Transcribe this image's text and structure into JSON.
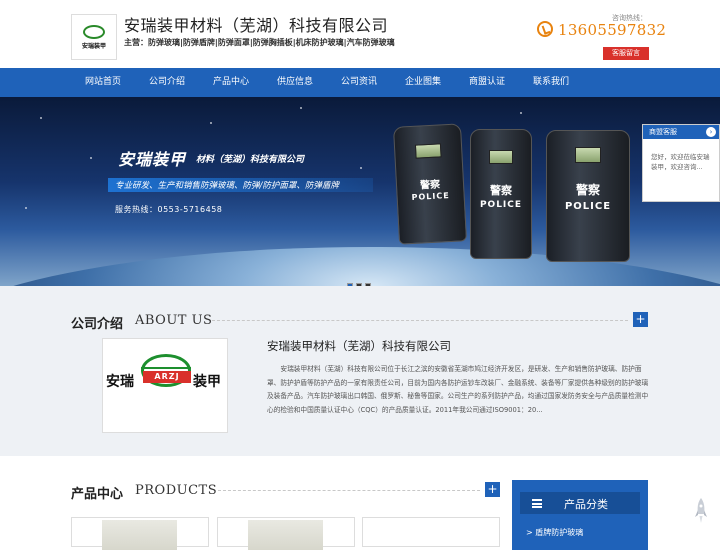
{
  "header": {
    "logo_text": "安瑞装甲",
    "company_name": "安瑞装甲材料（芜湖）科技有限公司",
    "business": "主营：防弹玻璃|防弹盾牌|防弹面罩|防弹胸插板|机床防护玻璃|汽车防弹玻璃",
    "hotline_label": "咨询热线：",
    "phone": "13605597832",
    "message_button": "客服留言"
  },
  "nav": {
    "items": [
      {
        "label": "网站首页"
      },
      {
        "label": "公司介绍"
      },
      {
        "label": "产品中心"
      },
      {
        "label": "供应信息"
      },
      {
        "label": "公司资讯"
      },
      {
        "label": "企业图集"
      },
      {
        "label": "商盟认证"
      },
      {
        "label": "联系我们"
      }
    ]
  },
  "banner": {
    "title": "安瑞装甲",
    "subtitle": "材料（芜湖）科技有限公司",
    "slogan": "专业研发、生产和销售防弹玻璃、防弹/防护面罩、防弹盾牌",
    "service": "服务热线：0553-5716458",
    "shield_cn": "警察",
    "shield_en": "POLICE",
    "slides": 3,
    "active_slide": 1
  },
  "chat": {
    "title": "商盟客服",
    "arrow": "›",
    "message": "您好，欢迎莅临安瑞装甲，欢迎咨询..."
  },
  "about": {
    "title_cn": "公司介绍",
    "title_en": "ABOUT US",
    "more": "+",
    "logo_left": "安瑞",
    "logo_band": "ARZJ",
    "logo_right": "装甲",
    "company": "安瑞装甲材料（芜湖）科技有限公司",
    "text": "安瑞装甲材料（芜湖）科技有限公司位于长江之滨的安徽省芜湖市鸠江经济开发区，是研发、生产和销售防护玻璃、防护面罩、防护护盾等防护产品的一家有限责任公司，目前为国内各防护运钞车改装厂、金融系统、装备等厂家提供各种级别的防护玻璃及装备产品。汽车防护玻璃出口韩国、俄罗斯、秘鲁等国家。公司生产的系列防护产品，均通过国家发防务安全与产品质量检测中心的检验和中国质量认证中心（CQC）的产品质量认证。2011年我公司通过ISO9001：20..."
  },
  "products": {
    "title_cn": "产品中心",
    "title_en": "PRODUCTS",
    "more": "+",
    "category_header": "产品分类",
    "category_item": "> 盾牌防护玻璃"
  },
  "colors": {
    "brand_blue": "#1f62b9",
    "accent_orange": "#e8830f",
    "button_red": "#d9312b"
  }
}
